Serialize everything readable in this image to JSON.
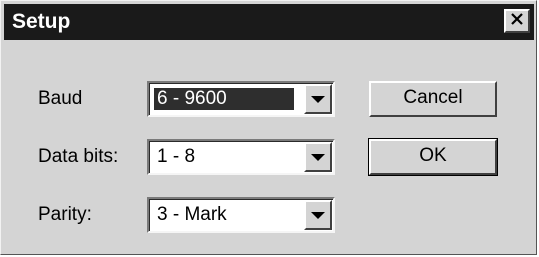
{
  "window": {
    "title": "Setup",
    "close_icon": "close-x-icon"
  },
  "fields": [
    {
      "label": "Baud",
      "value": "6 - 9600",
      "selected": true
    },
    {
      "label": "Data bits:",
      "value": "1 - 8",
      "selected": false
    },
    {
      "label": "Parity:",
      "value": "3 - Mark",
      "selected": false
    }
  ],
  "buttons": {
    "cancel_label": "Cancel",
    "ok_label": "OK"
  },
  "colors": {
    "titlebar": "#1a1a1a",
    "face": "#d4d4d4",
    "selection": "#2e2e2e"
  }
}
